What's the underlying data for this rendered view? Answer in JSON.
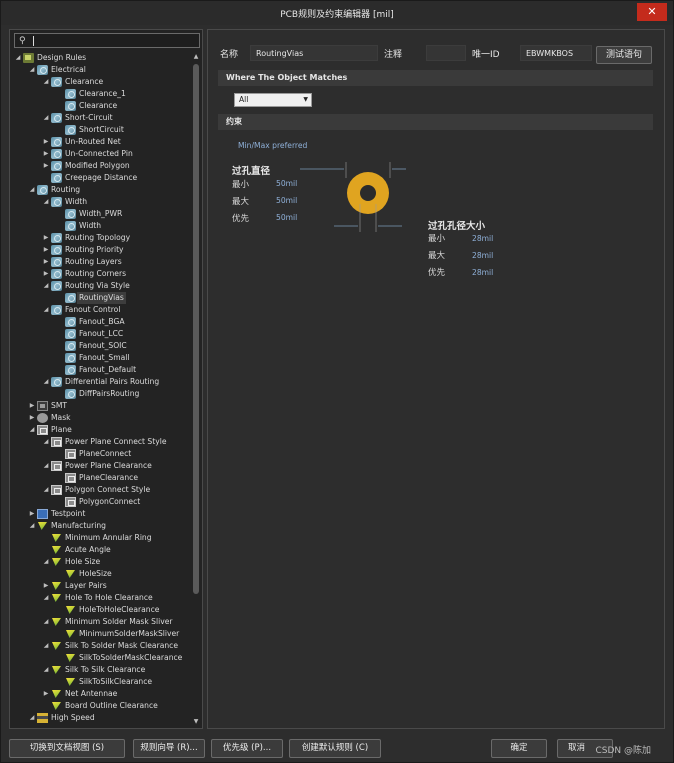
{
  "window": {
    "title": "PCB规则及约束编辑器 [mil]",
    "close_glyph": "✕"
  },
  "search": {
    "value": "",
    "placeholder": ""
  },
  "tree": [
    {
      "level": 0,
      "expanded": true,
      "icon": "design",
      "label": "Design Rules"
    },
    {
      "level": 1,
      "expanded": true,
      "icon": "rule",
      "label": "Electrical"
    },
    {
      "level": 2,
      "expanded": true,
      "icon": "rule",
      "label": "Clearance"
    },
    {
      "level": 3,
      "expanded": null,
      "icon": "rule",
      "label": "Clearance_1"
    },
    {
      "level": 3,
      "expanded": null,
      "icon": "rule",
      "label": "Clearance"
    },
    {
      "level": 2,
      "expanded": true,
      "icon": "rule",
      "label": "Short-Circuit"
    },
    {
      "level": 3,
      "expanded": null,
      "icon": "rule",
      "label": "ShortCircuit"
    },
    {
      "level": 2,
      "expanded": false,
      "icon": "rule",
      "label": "Un-Routed Net"
    },
    {
      "level": 2,
      "expanded": false,
      "icon": "rule",
      "label": "Un-Connected Pin"
    },
    {
      "level": 2,
      "expanded": false,
      "icon": "rule",
      "label": "Modified Polygon"
    },
    {
      "level": 2,
      "expanded": null,
      "icon": "rule",
      "label": "Creepage Distance"
    },
    {
      "level": 1,
      "expanded": true,
      "icon": "rule",
      "label": "Routing"
    },
    {
      "level": 2,
      "expanded": true,
      "icon": "rule",
      "label": "Width"
    },
    {
      "level": 3,
      "expanded": null,
      "icon": "rule",
      "label": "Width_PWR"
    },
    {
      "level": 3,
      "expanded": null,
      "icon": "rule",
      "label": "Width"
    },
    {
      "level": 2,
      "expanded": false,
      "icon": "rule",
      "label": "Routing Topology"
    },
    {
      "level": 2,
      "expanded": false,
      "icon": "rule",
      "label": "Routing Priority"
    },
    {
      "level": 2,
      "expanded": false,
      "icon": "rule",
      "label": "Routing Layers"
    },
    {
      "level": 2,
      "expanded": false,
      "icon": "rule",
      "label": "Routing Corners"
    },
    {
      "level": 2,
      "expanded": true,
      "icon": "rule",
      "label": "Routing Via Style"
    },
    {
      "level": 3,
      "expanded": null,
      "icon": "rule",
      "label": "RoutingVias",
      "selected": true
    },
    {
      "level": 2,
      "expanded": true,
      "icon": "rule",
      "label": "Fanout Control"
    },
    {
      "level": 3,
      "expanded": null,
      "icon": "rule",
      "label": "Fanout_BGA"
    },
    {
      "level": 3,
      "expanded": null,
      "icon": "rule",
      "label": "Fanout_LCC"
    },
    {
      "level": 3,
      "expanded": null,
      "icon": "rule",
      "label": "Fanout_SOIC"
    },
    {
      "level": 3,
      "expanded": null,
      "icon": "rule",
      "label": "Fanout_Small"
    },
    {
      "level": 3,
      "expanded": null,
      "icon": "rule",
      "label": "Fanout_Default"
    },
    {
      "level": 2,
      "expanded": true,
      "icon": "rule",
      "label": "Differential Pairs Routing"
    },
    {
      "level": 3,
      "expanded": null,
      "icon": "rule",
      "label": "DiffPairsRouting"
    },
    {
      "level": 1,
      "expanded": false,
      "icon": "smt",
      "label": "SMT"
    },
    {
      "level": 1,
      "expanded": false,
      "icon": "mask",
      "label": "Mask"
    },
    {
      "level": 1,
      "expanded": true,
      "icon": "plane",
      "label": "Plane"
    },
    {
      "level": 2,
      "expanded": true,
      "icon": "plane",
      "label": "Power Plane Connect Style"
    },
    {
      "level": 3,
      "expanded": null,
      "icon": "plane",
      "label": "PlaneConnect"
    },
    {
      "level": 2,
      "expanded": true,
      "icon": "plane",
      "label": "Power Plane Clearance"
    },
    {
      "level": 3,
      "expanded": null,
      "icon": "plane",
      "label": "PlaneClearance"
    },
    {
      "level": 2,
      "expanded": true,
      "icon": "plane",
      "label": "Polygon Connect Style"
    },
    {
      "level": 3,
      "expanded": null,
      "icon": "plane",
      "label": "PolygonConnect"
    },
    {
      "level": 1,
      "expanded": false,
      "icon": "test",
      "label": "Testpoint"
    },
    {
      "level": 1,
      "expanded": true,
      "icon": "mfg",
      "label": "Manufacturing"
    },
    {
      "level": 2,
      "expanded": null,
      "icon": "mfg",
      "label": "Minimum Annular Ring"
    },
    {
      "level": 2,
      "expanded": null,
      "icon": "mfg",
      "label": "Acute Angle"
    },
    {
      "level": 2,
      "expanded": true,
      "icon": "mfg",
      "label": "Hole Size"
    },
    {
      "level": 3,
      "expanded": null,
      "icon": "mfg",
      "label": "HoleSize"
    },
    {
      "level": 2,
      "expanded": false,
      "icon": "mfg",
      "label": "Layer Pairs"
    },
    {
      "level": 2,
      "expanded": true,
      "icon": "mfg",
      "label": "Hole To Hole Clearance"
    },
    {
      "level": 3,
      "expanded": null,
      "icon": "mfg",
      "label": "HoleToHoleClearance"
    },
    {
      "level": 2,
      "expanded": true,
      "icon": "mfg",
      "label": "Minimum Solder Mask Sliver"
    },
    {
      "level": 3,
      "expanded": null,
      "icon": "mfg",
      "label": "MinimumSolderMaskSliver"
    },
    {
      "level": 2,
      "expanded": true,
      "icon": "mfg",
      "label": "Silk To Solder Mask Clearance"
    },
    {
      "level": 3,
      "expanded": null,
      "icon": "mfg",
      "label": "SilkToSolderMaskClearance"
    },
    {
      "level": 2,
      "expanded": true,
      "icon": "mfg",
      "label": "Silk To Silk Clearance"
    },
    {
      "level": 3,
      "expanded": null,
      "icon": "mfg",
      "label": "SilkToSilkClearance"
    },
    {
      "level": 2,
      "expanded": false,
      "icon": "mfg",
      "label": "Net Antennae"
    },
    {
      "level": 2,
      "expanded": null,
      "icon": "mfg",
      "label": "Board Outline Clearance"
    },
    {
      "level": 1,
      "expanded": true,
      "icon": "hs",
      "label": "High Speed"
    }
  ],
  "rule": {
    "name_label": "名称",
    "name_value": "RoutingVias",
    "comment_label": "注释",
    "comment_value": "",
    "uid_label": "唯一ID",
    "uid_value": "EBWMKBOS",
    "test_button": "测试语句"
  },
  "match": {
    "section_title": "Where The Object Matches",
    "selected": "All"
  },
  "constraints": {
    "section_title": "约束",
    "mode": "Min/Max preferred",
    "via_diameter": {
      "title": "过孔直径",
      "rows": [
        {
          "label": "最小",
          "value": "50mil"
        },
        {
          "label": "最大",
          "value": "50mil"
        },
        {
          "label": "优先",
          "value": "50mil"
        }
      ]
    },
    "hole_size": {
      "title": "过孔孔径大小",
      "rows": [
        {
          "label": "最小",
          "value": "28mil"
        },
        {
          "label": "最大",
          "value": "28mil"
        },
        {
          "label": "优先",
          "value": "28mil"
        }
      ]
    }
  },
  "buttons": {
    "switch_view": "切换到文档视图 (S)",
    "rule_wizard": "规则向导 (R)...",
    "priorities": "优先级 (P)...",
    "create_default": "创建默认规则 (C)",
    "ok": "确定",
    "cancel": "取消"
  },
  "watermark": "CSDN @陈加",
  "colors": {
    "via_ring": "#e0a420",
    "via_hole": "#2b2b2b",
    "value_text": "#8fb0d8",
    "close_button": "#c42b1c"
  }
}
